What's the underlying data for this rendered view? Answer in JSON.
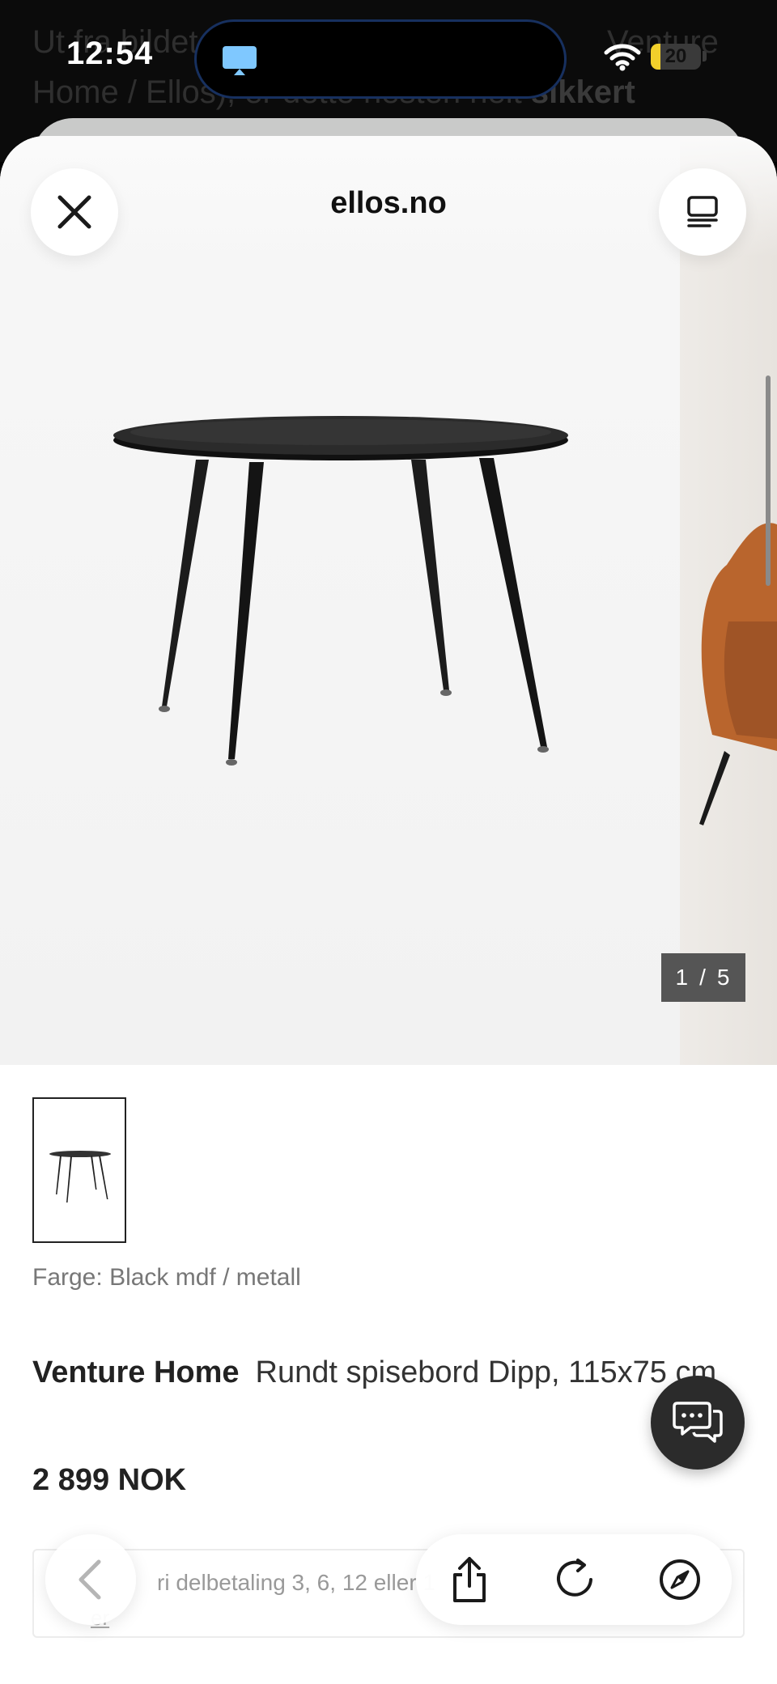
{
  "background_chat": {
    "line1": "Ut fra bildet",
    "line1_tail": "Venture",
    "line2": "Home / Ellos), er dette nesten helt",
    "line2_bold": "sikkert"
  },
  "status_bar": {
    "time": "12:54",
    "battery_level": "20",
    "battery_fraction": 0.2,
    "accent_color": "#f2d02b"
  },
  "browser": {
    "site_title": "ellos.no",
    "close_icon": "close-icon",
    "reader_icon": "reader-mode-icon"
  },
  "gallery": {
    "counter_current": "1",
    "counter_separator": "/",
    "counter_total": "5"
  },
  "product": {
    "color_label": "Farge:",
    "color_value": "Black mdf / metall",
    "brand": "Venture Home",
    "name": "Rundt spisebord Dipp, 115x75 cm",
    "price": "2 899 NOK"
  },
  "installment": {
    "text": "ri delbetaling 3, 6, 12 eller 1",
    "link": "er"
  },
  "toolbar": {
    "back_icon": "chevron-left-icon",
    "share_icon": "share-icon",
    "reload_icon": "reload-icon",
    "safari_icon": "compass-icon",
    "chat_icon": "chat-bubbles-icon"
  }
}
